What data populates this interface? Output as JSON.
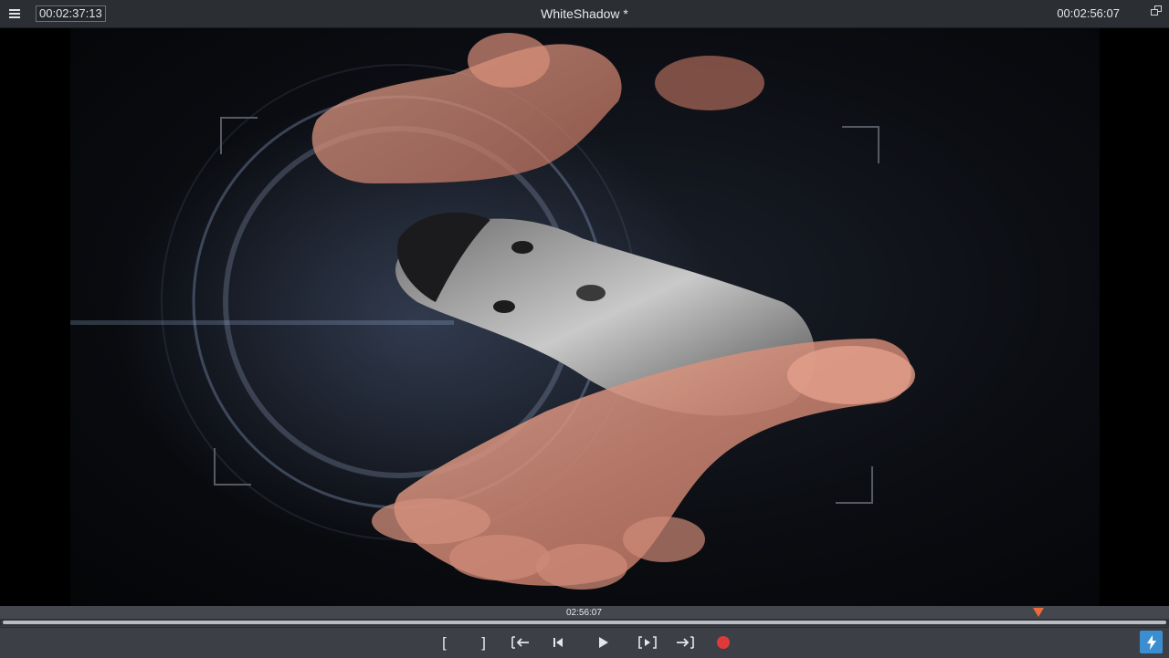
{
  "window": {
    "title": "WhiteShadow *",
    "current_timecode": "00:02:37:13",
    "total_timecode": "00:02:56:07"
  },
  "timeline": {
    "playhead_label": "02:56:07"
  },
  "transport": {
    "mark_in": "[",
    "mark_out": "]"
  },
  "colors": {
    "accent": "#3b8fd0",
    "record": "#e0393b",
    "marker": "#f06a3c"
  }
}
